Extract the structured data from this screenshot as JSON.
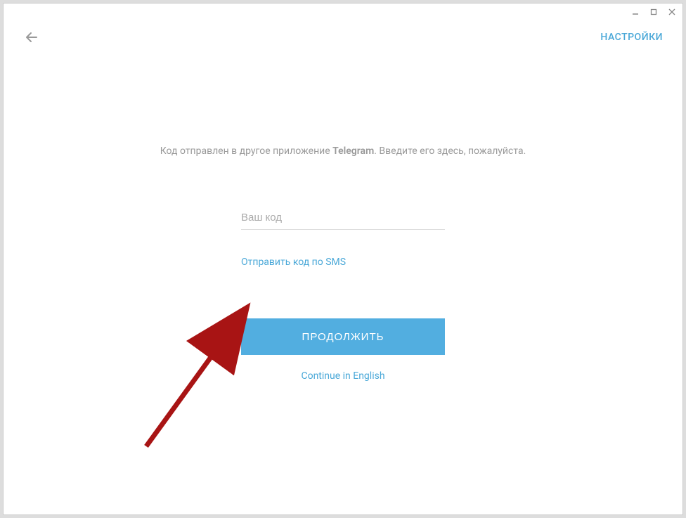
{
  "titlebar": {
    "minimize": "—",
    "maximize": "☐",
    "close": "✕"
  },
  "header": {
    "settings_label": "НАСТРОЙКИ"
  },
  "main": {
    "instruction_before": "Код отправлен в другое приложение ",
    "instruction_bold": "Telegram",
    "instruction_after": ". Введите его здесь, пожалуйста.",
    "code_placeholder": "Ваш код",
    "sms_link": "Отправить код по SMS",
    "continue_button": "ПРОДОЛЖИТЬ",
    "english_link": "Continue in English"
  },
  "colors": {
    "accent": "#4aa8d8",
    "button_bg": "#52aee0",
    "text_muted": "#999",
    "annotation_arrow": "#a81414"
  }
}
